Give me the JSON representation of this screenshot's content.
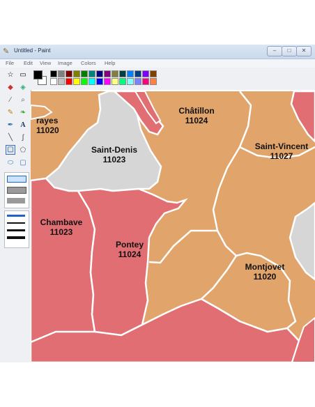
{
  "window": {
    "title": "Untitled - Paint"
  },
  "menu": [
    "File",
    "Edit",
    "View",
    "Image",
    "Colors",
    "Help"
  ],
  "palette": [
    "#000000",
    "#808080",
    "#800000",
    "#808000",
    "#008000",
    "#008080",
    "#000080",
    "#800080",
    "#808040",
    "#004040",
    "#0080ff",
    "#004080",
    "#8000ff",
    "#804000",
    "#ffffff",
    "#c0c0c0",
    "#ff0000",
    "#ffff00",
    "#00ff00",
    "#00ffff",
    "#0000ff",
    "#ff00ff",
    "#ffff80",
    "#00ff80",
    "#80ffff",
    "#8080ff",
    "#ff0080",
    "#ff8040"
  ],
  "colors": {
    "orange": "#e1a46b",
    "red": "#e06e72",
    "gray": "#d6d6d6",
    "border": "#ffffff"
  },
  "map": {
    "regions": [
      {
        "name": "rayes",
        "code": "11020"
      },
      {
        "name": "Saint-Denis",
        "code": "11023"
      },
      {
        "name": "Châtillon",
        "code": "11024"
      },
      {
        "name": "Saint-Vincent",
        "code": "11027"
      },
      {
        "name": "Chambave",
        "code": "11023"
      },
      {
        "name": "Pontey",
        "code": "11024"
      },
      {
        "name": "Montjovet",
        "code": "11020"
      }
    ]
  }
}
